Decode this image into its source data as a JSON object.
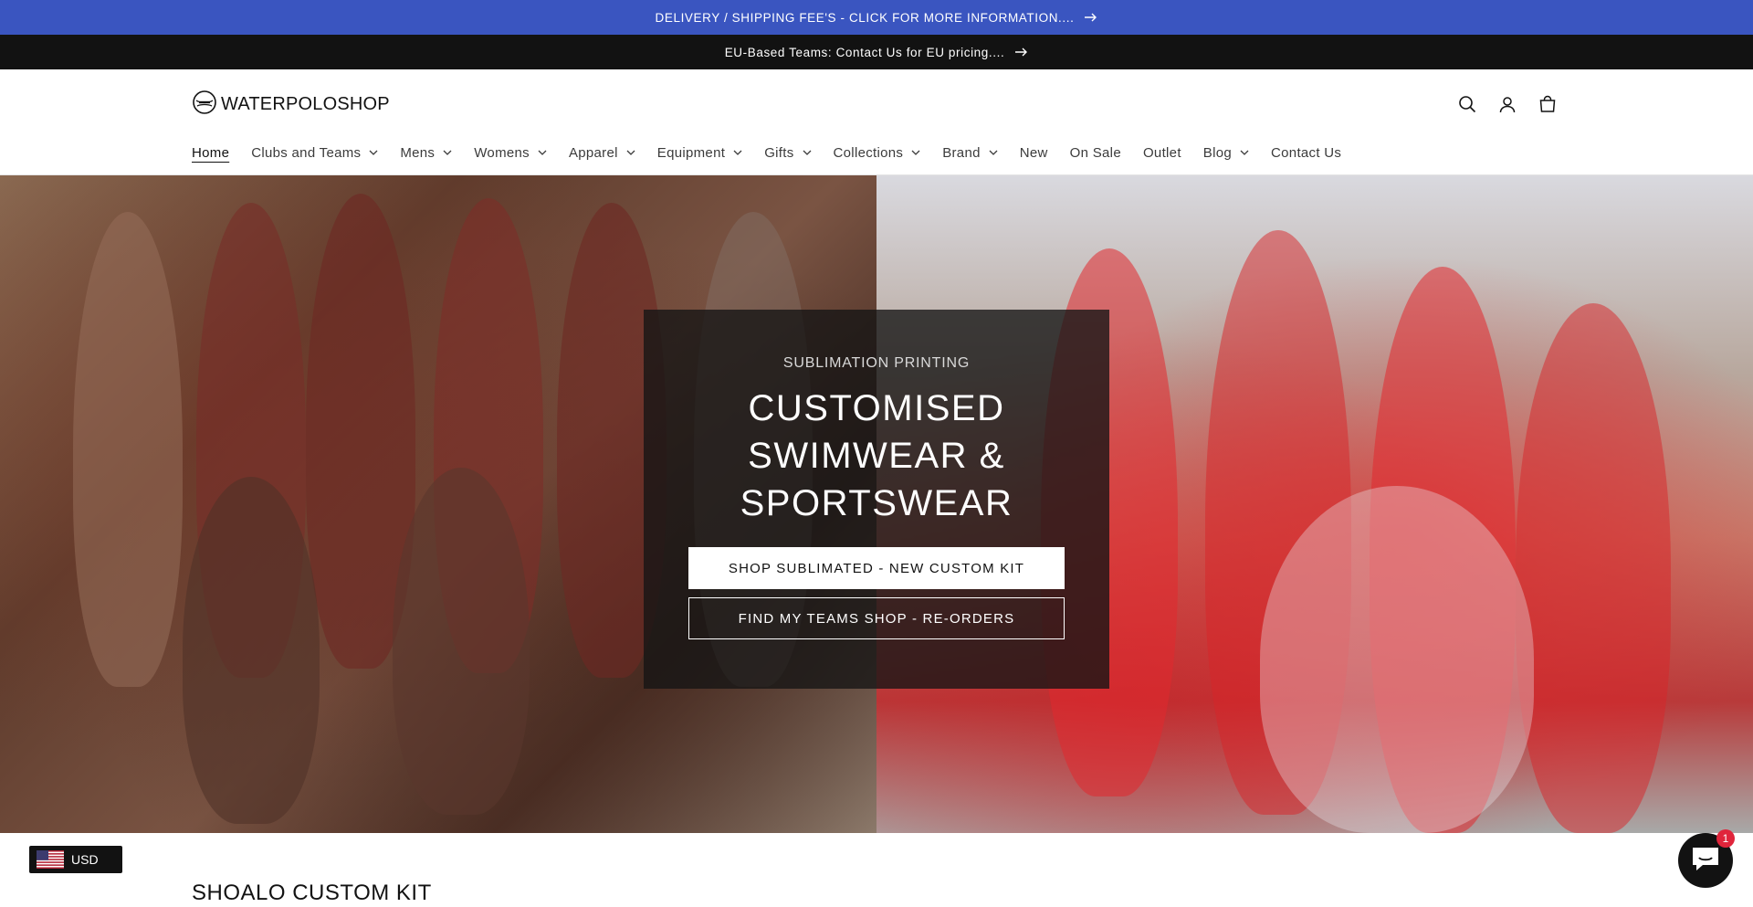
{
  "announcements": {
    "shipping": "DELIVERY / SHIPPING FEE'S - CLICK FOR MORE INFORMATION....",
    "eu": "EU-Based Teams: Contact Us for EU pricing...."
  },
  "header": {
    "logo_text": "WATERPOLOSHOP",
    "icons": [
      "search-icon",
      "account-icon",
      "cart-icon"
    ]
  },
  "nav": {
    "items": [
      {
        "label": "Home",
        "dropdown": false,
        "active": true
      },
      {
        "label": "Clubs and Teams",
        "dropdown": true
      },
      {
        "label": "Mens",
        "dropdown": true
      },
      {
        "label": "Womens",
        "dropdown": true
      },
      {
        "label": "Apparel",
        "dropdown": true
      },
      {
        "label": "Equipment",
        "dropdown": true
      },
      {
        "label": "Gifts",
        "dropdown": true
      },
      {
        "label": "Collections",
        "dropdown": true
      },
      {
        "label": "Brand",
        "dropdown": true
      },
      {
        "label": "New",
        "dropdown": false
      },
      {
        "label": "On Sale",
        "dropdown": false
      },
      {
        "label": "Outlet",
        "dropdown": false
      },
      {
        "label": "Blog",
        "dropdown": true
      },
      {
        "label": "Contact Us",
        "dropdown": false
      }
    ]
  },
  "hero": {
    "subheading": "SUBLIMATION PRINTING",
    "title_lines": [
      "CUSTOMISED",
      "SWIMWEAR &",
      "SPORTSWEAR"
    ],
    "primary_button": "SHOP SUBLIMATED - NEW CUSTOM KIT",
    "secondary_button": "FIND MY TEAMS SHOP - RE-ORDERS"
  },
  "section": {
    "title": "SHOALO CUSTOM KIT"
  },
  "currency": {
    "code": "USD"
  },
  "chat": {
    "badge_count": "1"
  },
  "colors": {
    "announcement_blue": "#3a55c0",
    "announcement_dark": "#121212",
    "badge_red": "#e0253b"
  }
}
